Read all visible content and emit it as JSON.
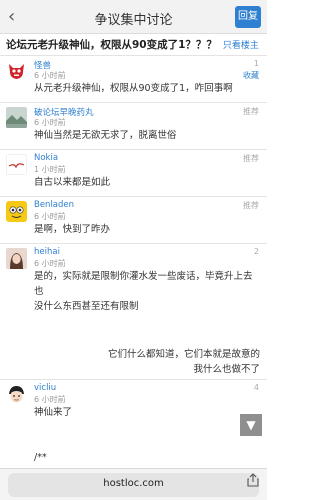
{
  "header": {
    "back_icon": "chevron-left-icon",
    "title": "争议集中讨论",
    "reply_label": "回复"
  },
  "thread": {
    "title": "论坛元老升级神仙，权限从90变成了1？？？",
    "only_op_label": "只看楼主"
  },
  "posts": [
    {
      "user": "怪兽",
      "time": "6 小时前",
      "floor": "1",
      "fav_label": "收藏",
      "content": "从元老升级神仙，权限从90变成了1，咋回事啊",
      "avatar_icon": "red-monster-avatar"
    },
    {
      "user": "破论坛早晚药丸",
      "time": "6 小时前",
      "floor": "推荐",
      "content": "神仙当然是无欲无求了，脱离世俗",
      "avatar_icon": "landscape-avatar"
    },
    {
      "user": "Nokia",
      "time": "1 小时前",
      "floor": "推荐",
      "content": "自古以来都是如此",
      "avatar_icon": "nokia-avatar"
    },
    {
      "user": "Benladen",
      "time": "6 小时前",
      "floor": "推荐",
      "content": "是啊，快到了昨办",
      "avatar_icon": "yellow-face-avatar"
    },
    {
      "user": "heihai",
      "time": "6 小时前",
      "floor": "2",
      "content_lines": [
        "是的，实际就是限制你灌水发一些废话，毕竟升上去也",
        "没什么东西甚至还有限制"
      ],
      "right_lines": [
        "它们什么都知道，它们本就是故意的",
        "我什么也做不了"
      ],
      "avatar_icon": "girl-avatar"
    },
    {
      "user": "vicliu",
      "time": "6 小时前",
      "floor": "4",
      "content": "神仙来了",
      "trailing": "/**",
      "avatar_icon": "cartoon-boy-avatar"
    }
  ],
  "scroll_icon": "scroll-down-icon",
  "browser": {
    "url": "hostloc.com",
    "share_icon": "share-icon"
  },
  "colors": {
    "accent": "#2f80d1",
    "header_bg": "#f2f2f2"
  }
}
